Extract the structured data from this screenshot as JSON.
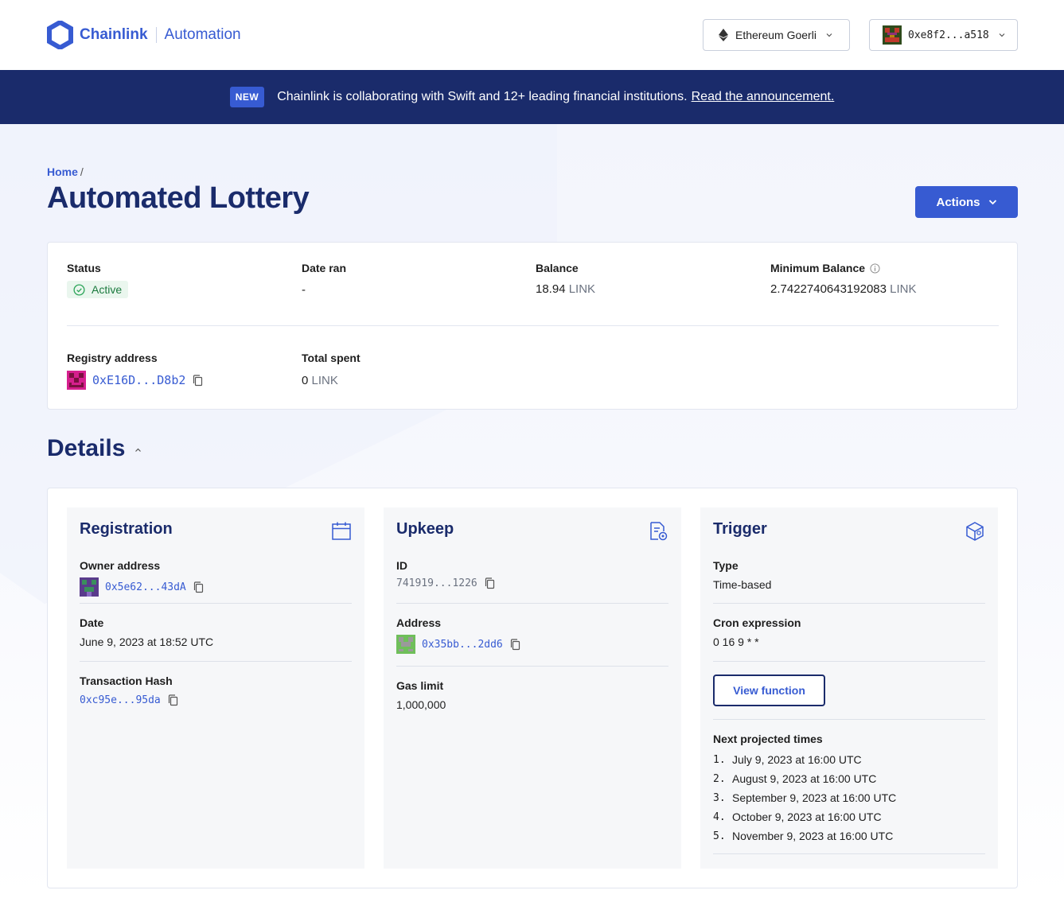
{
  "header": {
    "brand": "Chainlink",
    "product": "Automation",
    "network": "Ethereum Goerli",
    "wallet": "0xe8f2...a518"
  },
  "banner": {
    "badge": "NEW",
    "text": "Chainlink is collaborating with Swift and 12+ leading financial institutions.",
    "link": "Read the announcement."
  },
  "breadcrumb": {
    "home": "Home",
    "sep": "/"
  },
  "page": {
    "title": "Automated Lottery",
    "actions_label": "Actions"
  },
  "summary": {
    "status_label": "Status",
    "status_value": "Active",
    "date_ran_label": "Date ran",
    "date_ran_value": "-",
    "balance_label": "Balance",
    "balance_amount": "18.94",
    "balance_unit": "LINK",
    "min_balance_label": "Minimum Balance",
    "min_balance_amount": "2.7422740643192083",
    "min_balance_unit": "LINK",
    "registry_label": "Registry address",
    "registry_value": "0xE16D...D8b2",
    "total_spent_label": "Total spent",
    "total_spent_amount": "0",
    "total_spent_unit": "LINK"
  },
  "details": {
    "title": "Details",
    "registration": {
      "title": "Registration",
      "owner_label": "Owner address",
      "owner_value": "0x5e62...43dA",
      "date_label": "Date",
      "date_value": "June 9, 2023 at 18:52 UTC",
      "tx_label": "Transaction Hash",
      "tx_value": "0xc95e...95da"
    },
    "upkeep": {
      "title": "Upkeep",
      "id_label": "ID",
      "id_value": "741919...1226",
      "address_label": "Address",
      "address_value": "0x35bb...2dd6",
      "gas_label": "Gas limit",
      "gas_value": "1,000,000"
    },
    "trigger": {
      "title": "Trigger",
      "type_label": "Type",
      "type_value": "Time-based",
      "cron_label": "Cron expression",
      "cron_value": "0 16 9 * *",
      "view_function": "View function",
      "next_label": "Next projected times",
      "times": [
        {
          "n": "1.",
          "t": "July 9, 2023 at 16:00 UTC"
        },
        {
          "n": "2.",
          "t": "August 9, 2023 at 16:00 UTC"
        },
        {
          "n": "3.",
          "t": "September 9, 2023 at 16:00 UTC"
        },
        {
          "n": "4.",
          "t": "October 9, 2023 at 16:00 UTC"
        },
        {
          "n": "5.",
          "t": "November 9, 2023 at 16:00 UTC"
        }
      ]
    }
  },
  "colors": {
    "primary": "#375bd2",
    "navy": "#1a2b6b",
    "active_green": "#1b7a3e"
  }
}
